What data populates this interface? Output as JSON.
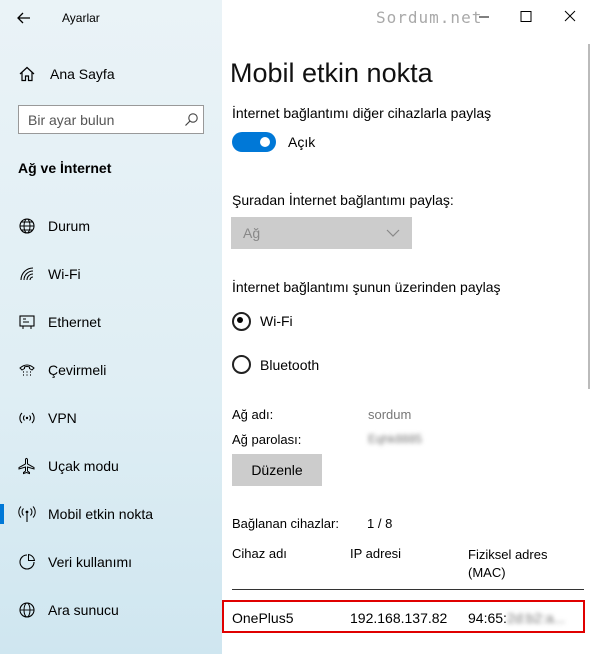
{
  "window": {
    "title": "Ayarlar",
    "watermark": "Sordum.net",
    "controls": {
      "minimize": "—",
      "maximize": "☐",
      "close": "✕"
    }
  },
  "sidebar": {
    "home_label": "Ana Sayfa",
    "search_placeholder": "Bir ayar bulun",
    "section_title": "Ağ ve İnternet",
    "items": [
      {
        "label": "Durum",
        "icon": "globe-icon"
      },
      {
        "label": "Wi-Fi",
        "icon": "wifi-icon"
      },
      {
        "label": "Ethernet",
        "icon": "ethernet-icon"
      },
      {
        "label": "Çevirmeli",
        "icon": "dialup-icon"
      },
      {
        "label": "VPN",
        "icon": "vpn-icon"
      },
      {
        "label": "Uçak modu",
        "icon": "airplane-icon"
      },
      {
        "label": "Mobil etkin nokta",
        "icon": "hotspot-icon",
        "selected": true
      },
      {
        "label": "Veri kullanımı",
        "icon": "data-usage-icon"
      },
      {
        "label": "Ara sunucu",
        "icon": "proxy-globe-icon"
      }
    ],
    "accent_color": "#0078d7"
  },
  "main": {
    "page_title": "Mobil etkin nokta",
    "share_label": "İnternet bağlantımı diğer cihazlarla paylaş",
    "toggle_state": "Açık",
    "share_from_label": "Şuradan İnternet bağlantımı paylaş:",
    "share_from_value": "Ağ",
    "share_over_label": "İnternet bağlantımı şunun üzerinden paylaş",
    "radio_wifi": "Wi-Fi",
    "radio_bluetooth": "Bluetooth",
    "network_name_label": "Ağ adı:",
    "network_name_value": "sordum",
    "network_password_label": "Ağ parolası:",
    "network_password_value": "Eqhk8885",
    "edit_button": "Düzenle",
    "connected_label": "Bağlanan cihazlar:",
    "connected_value": "1 / 8",
    "table": {
      "headers": [
        "Cihaz adı",
        "IP adresi",
        "Fiziksel adres (MAC)"
      ],
      "rows": [
        {
          "device": "OnePlus5",
          "ip": "192.168.137.82",
          "mac_visible": "94:65:",
          "mac_hidden": "2d:b2:a..."
        }
      ]
    }
  }
}
